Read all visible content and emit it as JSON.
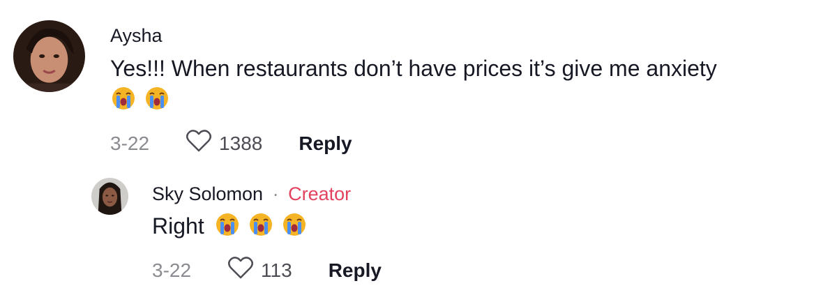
{
  "comments": [
    {
      "username": "Aysha",
      "text": "Yes!!! When restaurants don’t have prices it’s give me anxiety",
      "emojis": [
        "loudly-crying-face",
        "loudly-crying-face"
      ],
      "date": "3-22",
      "likes": "1388",
      "reply_label": "Reply",
      "avatar_icon": "avatar-photo"
    }
  ],
  "reply": {
    "username": "Sky Solomon",
    "separator": "·",
    "badge": "Creator",
    "text": "Right",
    "emojis": [
      "loudly-crying-face",
      "loudly-crying-face",
      "loudly-crying-face"
    ],
    "date": "3-22",
    "likes": "113",
    "reply_label": "Reply",
    "avatar_icon": "avatar-photo"
  },
  "colors": {
    "text": "#161823",
    "muted": "#8a8b91",
    "creator": "#e3425f"
  }
}
